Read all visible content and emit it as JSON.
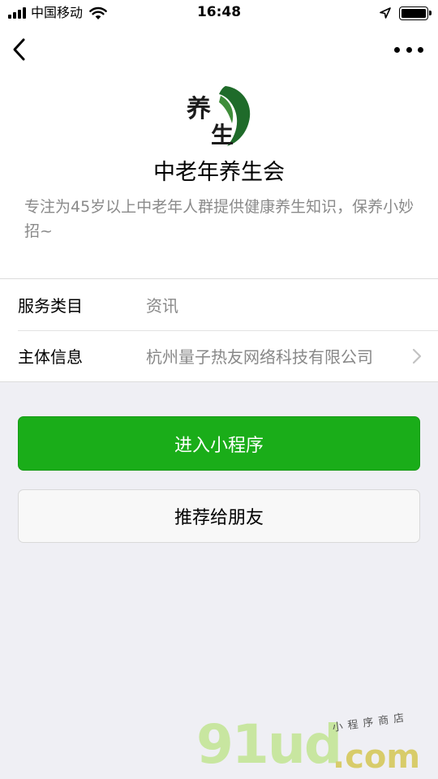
{
  "status_bar": {
    "carrier": "中国移动",
    "time": "16:48"
  },
  "nav": {
    "back_icon": "chevron-left-icon",
    "more_icon": "more-dots-icon"
  },
  "profile": {
    "logo_text_top": "养",
    "logo_text_bottom": "生",
    "name": "中老年养生会",
    "description": "专注为45岁以上中老年人群提供健康养生知识，保养小妙招~"
  },
  "info": {
    "rows": [
      {
        "label": "服务类目",
        "value": "资讯"
      },
      {
        "label": "主体信息",
        "value": "杭州量子热友网络科技有限公司"
      }
    ]
  },
  "actions": {
    "enter_label": "进入小程序",
    "share_label": "推荐给朋友"
  },
  "watermark": {
    "brand": "91ud",
    "domain": ".com",
    "tagline": "小程序商店"
  },
  "colors": {
    "primary_green": "#1aad19",
    "background": "#efeff4",
    "logo_green": "#1f6b2a"
  }
}
